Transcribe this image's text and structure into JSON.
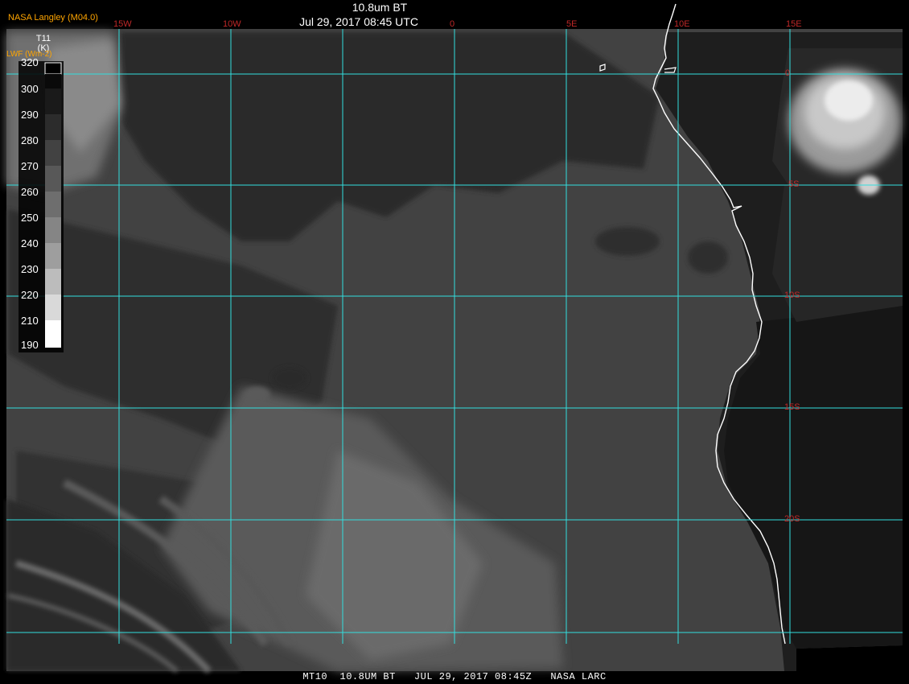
{
  "title": "10.8um BT",
  "subtitle": "Jul 29, 2017 08:45 UTC",
  "credit": "NASA Langley (M04.0)",
  "legend": {
    "title_line1": "T11",
    "title_line2": "(K)",
    "units_label": "LWF (Wm-2)",
    "ticks": [
      "320",
      "300",
      "290",
      "280",
      "270",
      "260",
      "250",
      "240",
      "230",
      "220",
      "210",
      "190"
    ]
  },
  "longitude_labels": [
    "15W",
    "10W",
    "0",
    "5E",
    "10E",
    "15E"
  ],
  "latitude_labels": [
    "0",
    "5S",
    "10S",
    "15S",
    "20S"
  ],
  "footer": "MT10  10.8UM BT   JUL 29, 2017 08:45Z   NASA LARC",
  "colors": {
    "grid": "#33dede",
    "labels": "#c02828",
    "coastline": "#ffffff",
    "credit": "#ffa500",
    "ocean": "#424242"
  }
}
